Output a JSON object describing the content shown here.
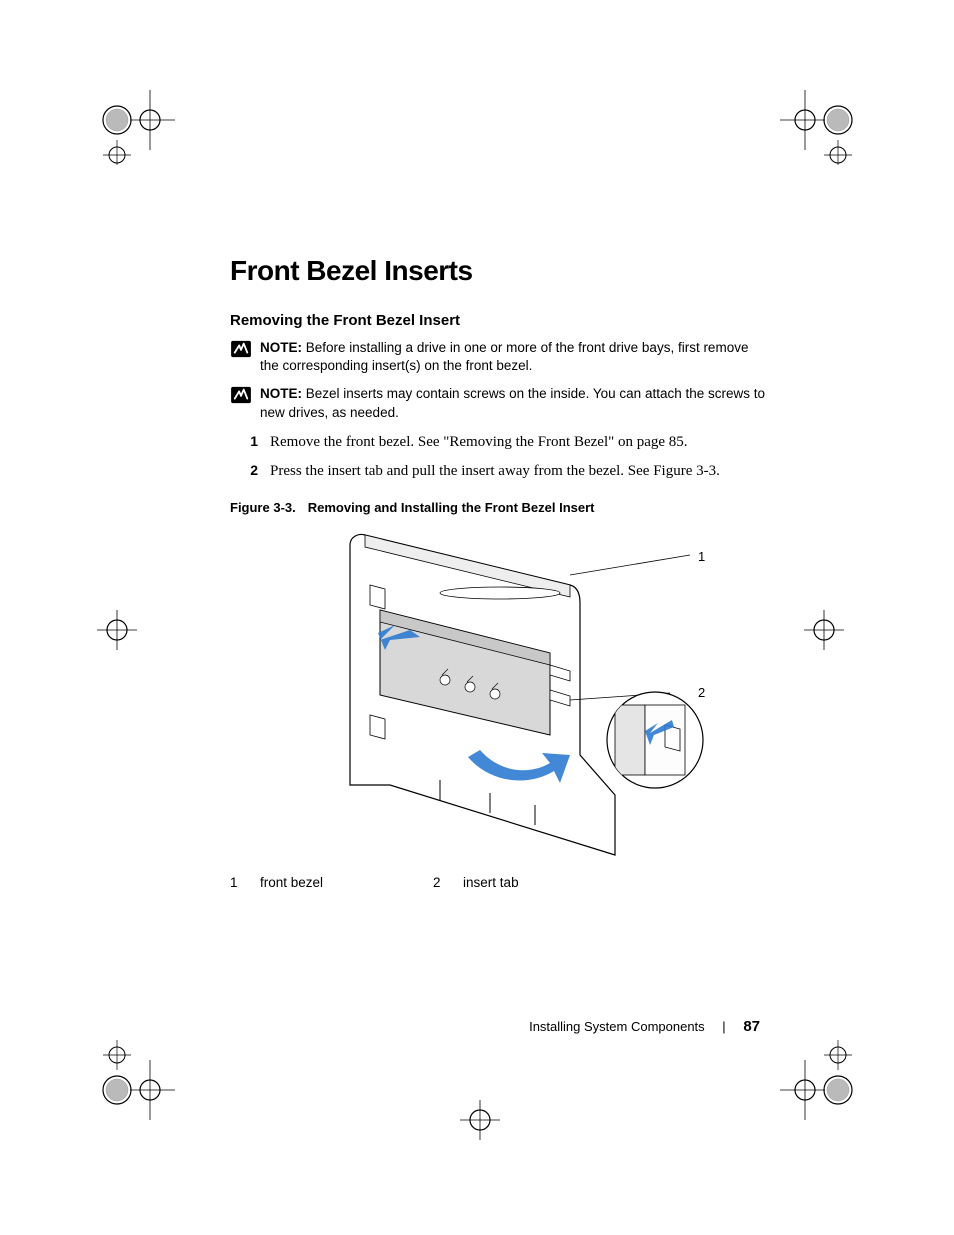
{
  "heading": "Front Bezel Inserts",
  "subheading": "Removing the Front Bezel Insert",
  "notes": [
    {
      "label": "NOTE:",
      "text": " Before installing a drive in one or more of the front drive bays, first remove the corresponding insert(s) on the front bezel."
    },
    {
      "label": "NOTE:",
      "text": " Bezel inserts may contain screws on the inside. You can attach the screws to new drives, as needed."
    }
  ],
  "steps": [
    {
      "num": "1",
      "text": "Remove the front bezel. See \"Removing the Front Bezel\" on page 85."
    },
    {
      "num": "2",
      "text": "Press the insert tab and pull the insert away from the bezel. See Figure 3-3."
    }
  ],
  "figure": {
    "label": "Figure 3-3.",
    "title": "Removing and Installing the Front Bezel Insert",
    "callouts": {
      "c1": "1",
      "c2": "2"
    },
    "legend": [
      {
        "num": "1",
        "text": "front bezel"
      },
      {
        "num": "2",
        "text": "insert tab"
      }
    ]
  },
  "footer": {
    "section": "Installing System Components",
    "page": "87"
  }
}
